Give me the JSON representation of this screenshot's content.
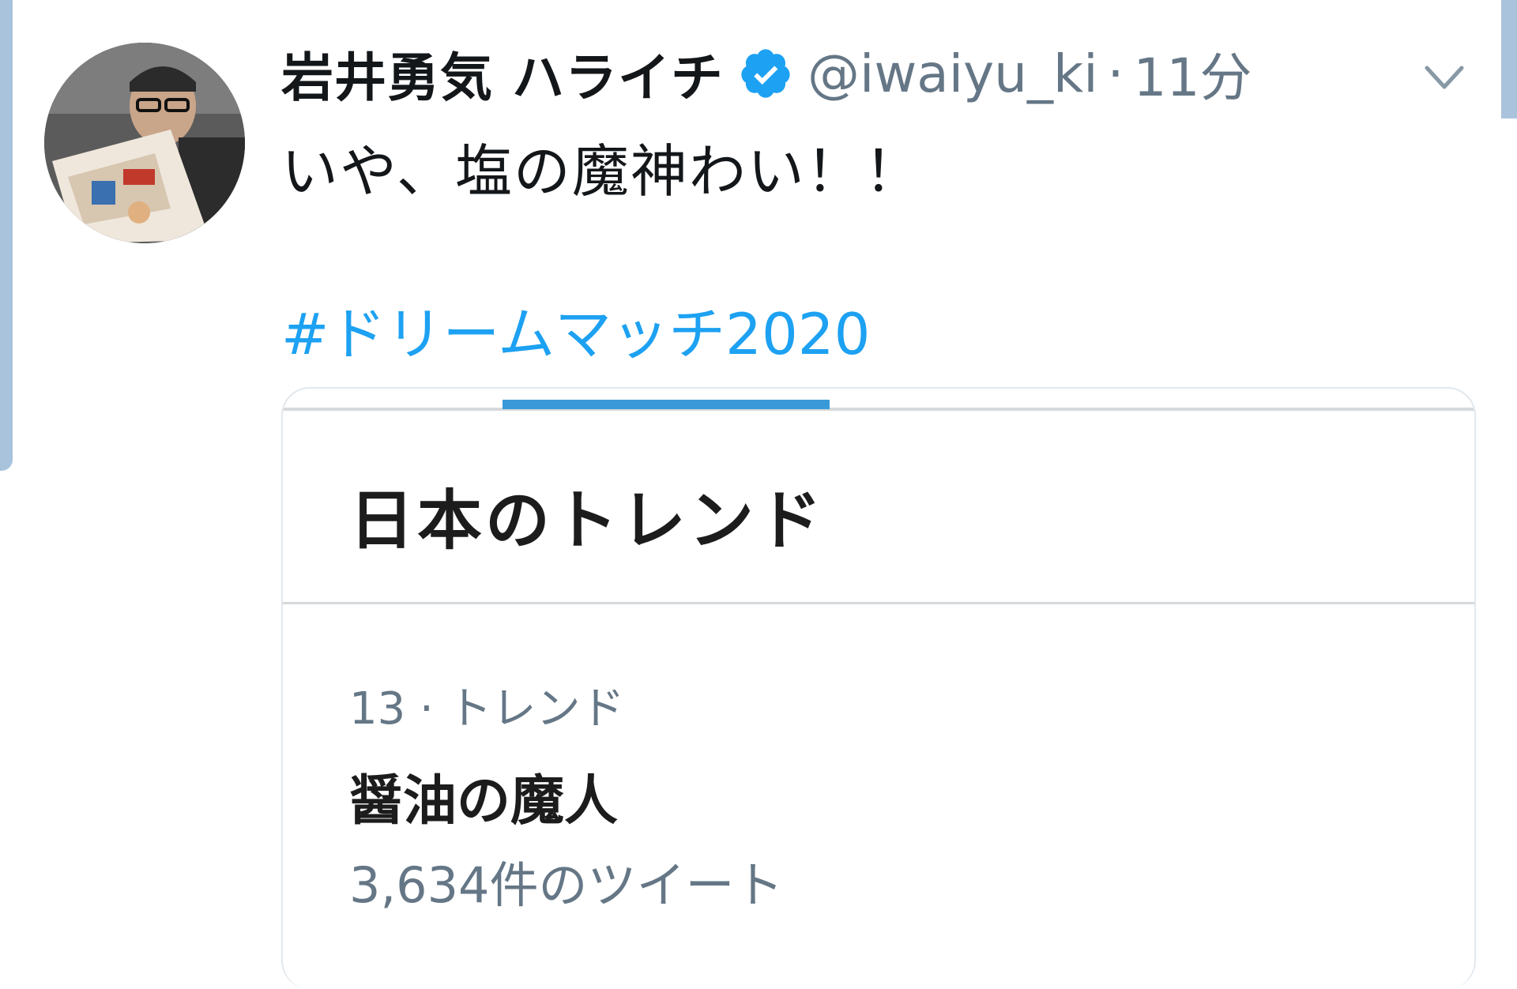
{
  "tweet": {
    "display_name": "岩井勇気 ハライチ",
    "handle": "@iwaiyu_ki",
    "separator": "·",
    "time": "11分",
    "text": "いや、塩の魔神わい！！",
    "hashtag": "#ドリームマッチ2020"
  },
  "embedded_card": {
    "title": "日本のトレンド",
    "trend": {
      "meta": "13 · トレンド",
      "name": "醤油の魔人",
      "count": "3,634件のツイート"
    }
  },
  "colors": {
    "link": "#1da1f2",
    "verified": "#1da1f2",
    "secondary_text": "#657786",
    "tab_active": "#3a9ad9"
  },
  "icons": {
    "verified": "verified-badge-icon",
    "caret": "chevron-down-icon"
  }
}
